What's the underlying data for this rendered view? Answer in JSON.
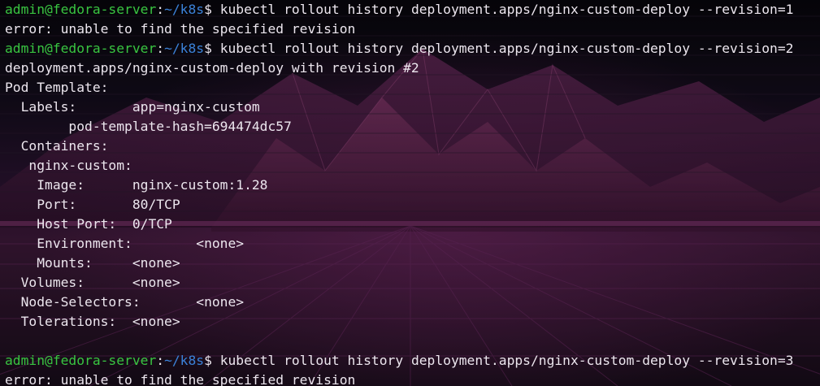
{
  "terminal": {
    "prompt": {
      "user_host": "admin@fedora-server",
      "separator": ":",
      "path": "~/k8s",
      "symbol": "$ "
    },
    "lines": [
      {
        "type": "command",
        "text": "kubectl rollout history deployment.apps/nginx-custom-deploy --revision=1"
      },
      {
        "type": "output",
        "text": "error: unable to find the specified revision"
      },
      {
        "type": "command",
        "text": "kubectl rollout history deployment.apps/nginx-custom-deploy --revision=2"
      },
      {
        "type": "output",
        "text": "deployment.apps/nginx-custom-deploy with revision #2"
      },
      {
        "type": "output",
        "text": "Pod Template:"
      },
      {
        "type": "output",
        "text": "  Labels:       app=nginx-custom"
      },
      {
        "type": "output",
        "text": "\tpod-template-hash=694474dc57"
      },
      {
        "type": "output",
        "text": "  Containers:"
      },
      {
        "type": "output",
        "text": "   nginx-custom:"
      },
      {
        "type": "output",
        "text": "    Image:      nginx-custom:1.28"
      },
      {
        "type": "output",
        "text": "    Port:       80/TCP"
      },
      {
        "type": "output",
        "text": "    Host Port:  0/TCP"
      },
      {
        "type": "output",
        "text": "    Environment:\t<none>"
      },
      {
        "type": "output",
        "text": "    Mounts:     <none>"
      },
      {
        "type": "output",
        "text": "  Volumes:      <none>"
      },
      {
        "type": "output",
        "text": "  Node-Selectors:\t<none>"
      },
      {
        "type": "output",
        "text": "  Tolerations:  <none>"
      },
      {
        "type": "output",
        "text": ""
      },
      {
        "type": "command",
        "text": "kubectl rollout history deployment.apps/nginx-custom-deploy --revision=3"
      },
      {
        "type": "output",
        "text": "error: unable to find the specified revision"
      }
    ]
  },
  "colors": {
    "user_host": "#39c541",
    "path": "#3b82d9",
    "text": "#ece6ee",
    "background": "#0f0a14"
  }
}
